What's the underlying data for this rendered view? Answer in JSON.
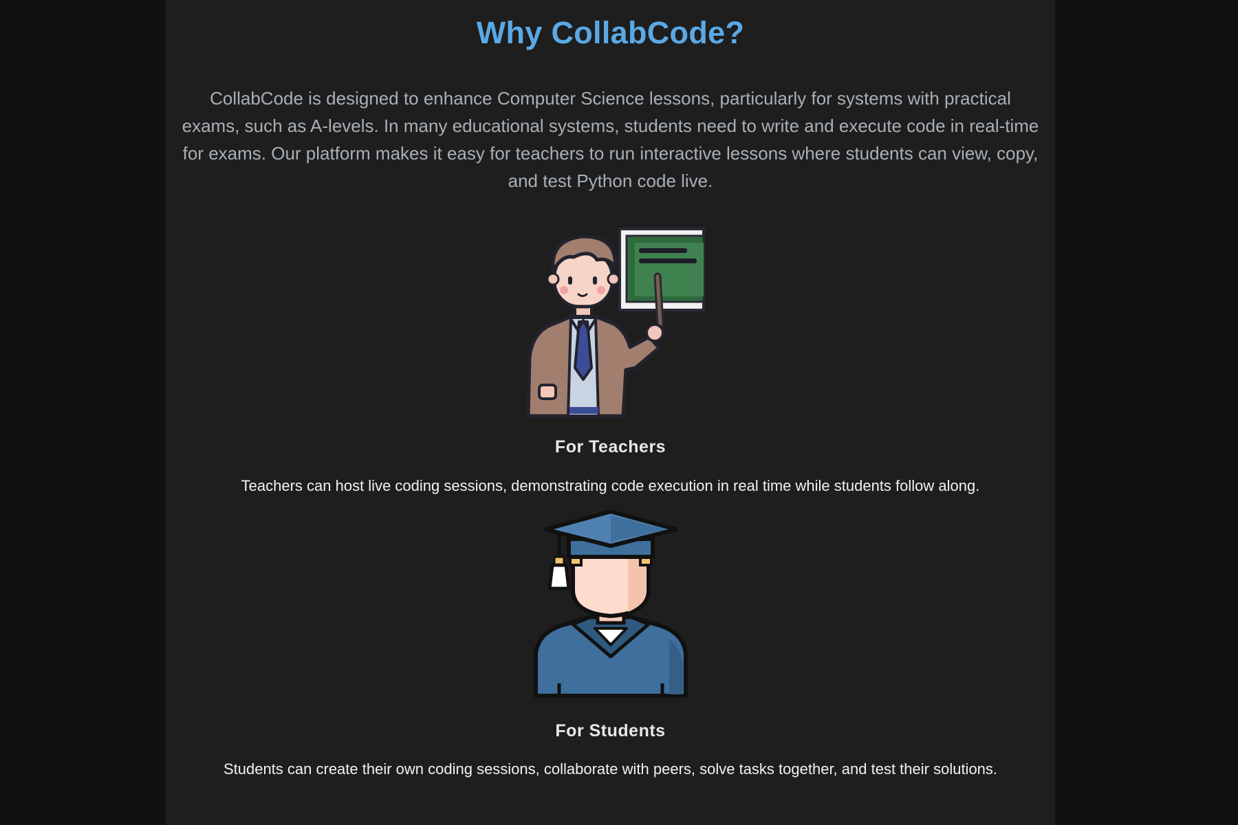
{
  "heading": "Why CollabCode?",
  "intro": "CollabCode is designed to enhance Computer Science lessons, particularly for systems with practical exams, such as A-levels. In many educational systems, students need to write and execute code in real-time for exams. Our platform makes it easy for teachers to run interactive lessons where students can view, copy, and test Python code live.",
  "teachers": {
    "title": "For Teachers",
    "description": "Teachers can host live coding sessions, demonstrating code execution in real time while students follow along.",
    "icon": "teacher-illustration"
  },
  "students": {
    "title": "For Students",
    "description": "Students can create their own coding sessions, collaborate with peers, solve tasks together, and test their solutions.",
    "icon": "student-illustration"
  },
  "colors": {
    "page_background": "#111111",
    "panel_background": "#1e1e1e",
    "heading": "#5aa9e6",
    "intro_text": "#a9b0b8",
    "body_text": "#f2f2f2"
  }
}
